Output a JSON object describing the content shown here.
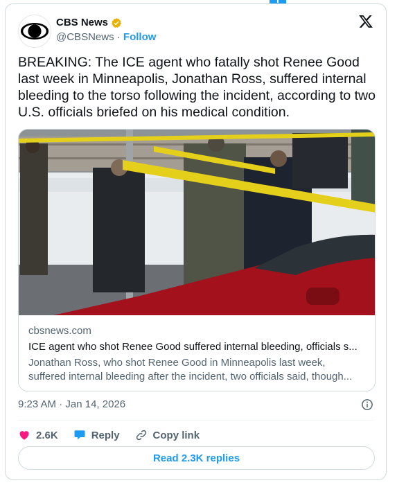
{
  "account": {
    "name": "CBS News",
    "handle": "@CBSNews",
    "separator": "·",
    "follow_label": "Follow",
    "verified_color": "#e8b100",
    "logo_icon": "cbs-eye-logo"
  },
  "tweet": {
    "text": "BREAKING: The ICE agent who fatally shot Renee Good last week in Minneapolis, Jonathan Ross, suffered internal bleeding to the torso following the incident, according to two U.S. officials briefed on his medical condition.",
    "time": "9:23 AM",
    "date": "Jan 14, 2026"
  },
  "link_card": {
    "domain": "cbsnews.com",
    "title": "ICE agent who shot Renee Good suffered internal bleeding, officials s...",
    "description_line1": "Jonathan Ross, who shot Renee Good in Minneapolis last week,",
    "description_line2": "suffered internal bleeding after the incident, two officials said, though..."
  },
  "actions": {
    "likes_count": "2.6K",
    "reply_label": "Reply",
    "copy_link_label": "Copy link"
  },
  "read_replies_label": "Read 2.3K replies",
  "colors": {
    "accent": "#1d9bf0",
    "like": "#f91880",
    "muted": "#536471",
    "border": "#cfd9de"
  }
}
